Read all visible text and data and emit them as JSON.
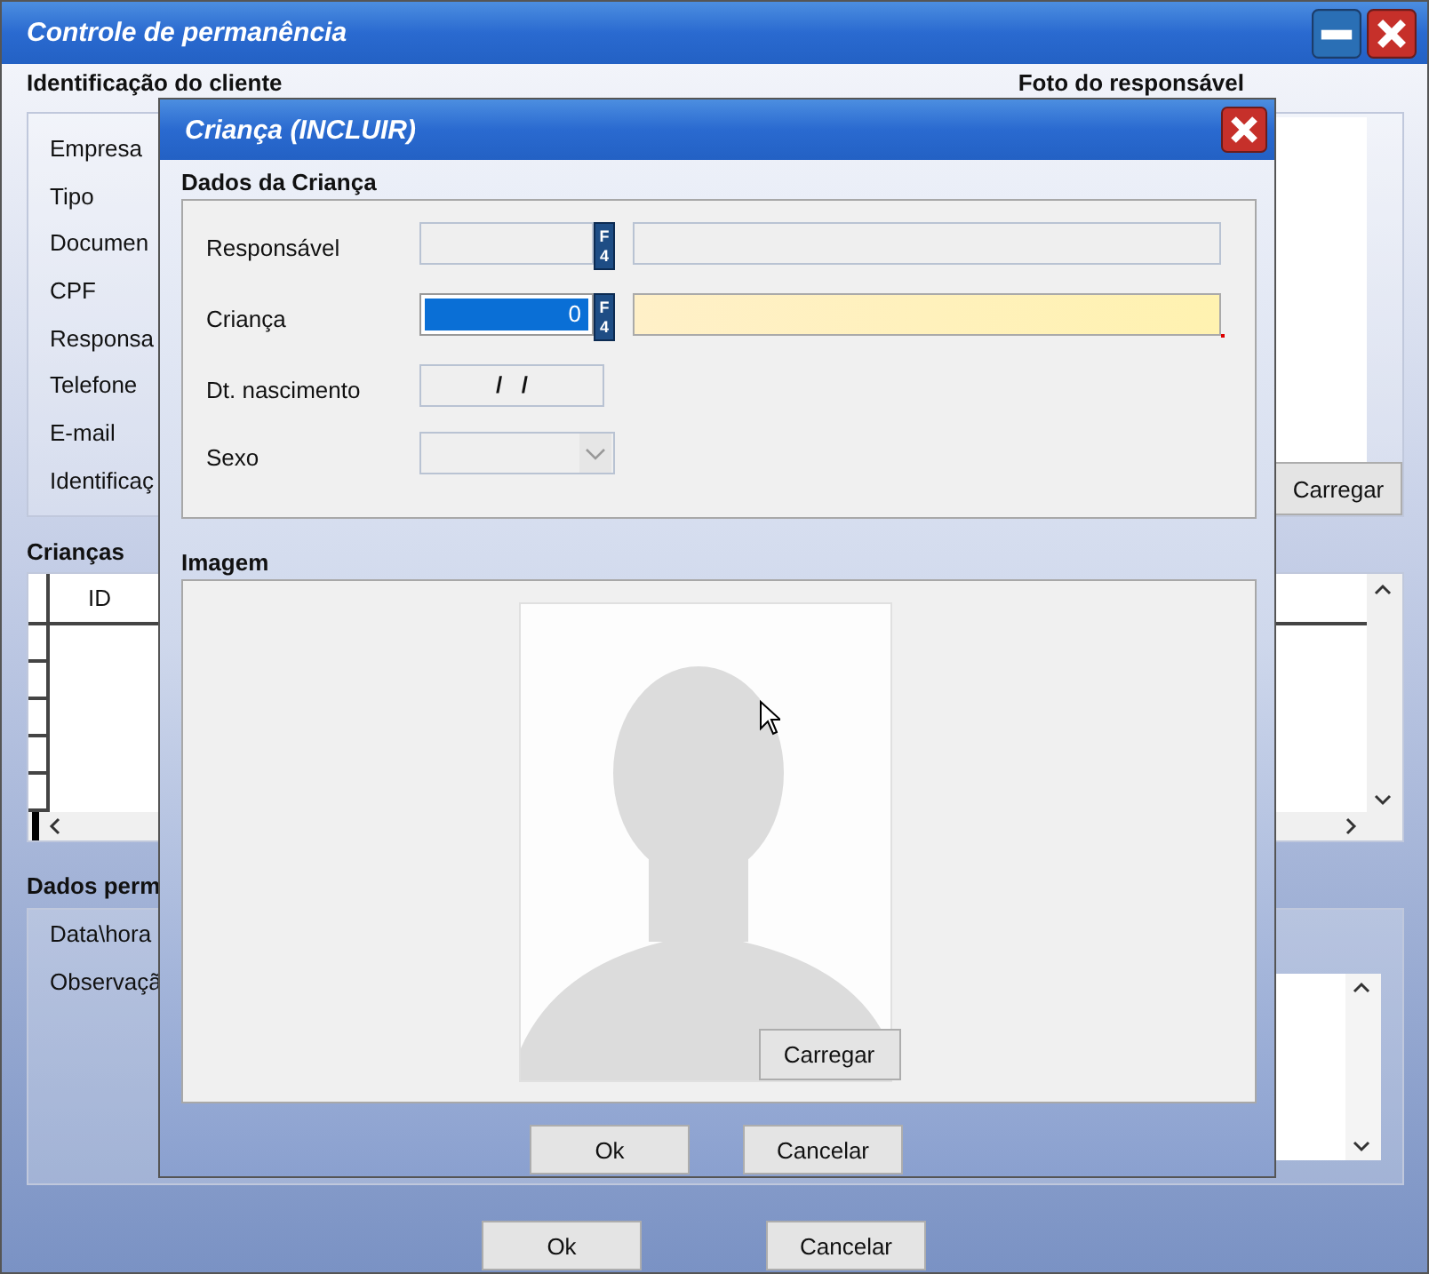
{
  "window": {
    "title": "Controle de permanência"
  },
  "client_section": {
    "title": "Identificação do cliente",
    "fields": [
      "Empresa",
      "Tipo",
      "Documen",
      "CPF",
      "Responsa",
      "Telefone",
      "E-mail",
      "Identificaç"
    ]
  },
  "photo_section": {
    "title": "Foto do responsável",
    "button": "Carregar"
  },
  "children_section": {
    "title": "Crianças",
    "columns": [
      "ID"
    ]
  },
  "stay_section": {
    "title": "Dados perm",
    "fields": [
      "Data\\hora",
      "Observaçã"
    ]
  },
  "buttons": [
    "Ok",
    "Cancelar"
  ],
  "dialog": {
    "title": "Criança (INCLUIR)",
    "section_title": "Dados da Criança",
    "fields": [
      {
        "label": "Responsável",
        "kind": "lookup",
        "key": "F4",
        "focused": false,
        "required": false
      },
      {
        "label": "Criança",
        "kind": "lookup",
        "key": "F4",
        "value": "0",
        "focused": true,
        "required": true
      },
      {
        "label": "Dt. nascimento",
        "kind": "date",
        "value": "/   /"
      },
      {
        "label": "Sexo",
        "kind": "select"
      }
    ],
    "image_section": {
      "title": "Imagem",
      "button": "Carregar"
    },
    "buttons": [
      "Ok",
      "Cancelar"
    ]
  }
}
